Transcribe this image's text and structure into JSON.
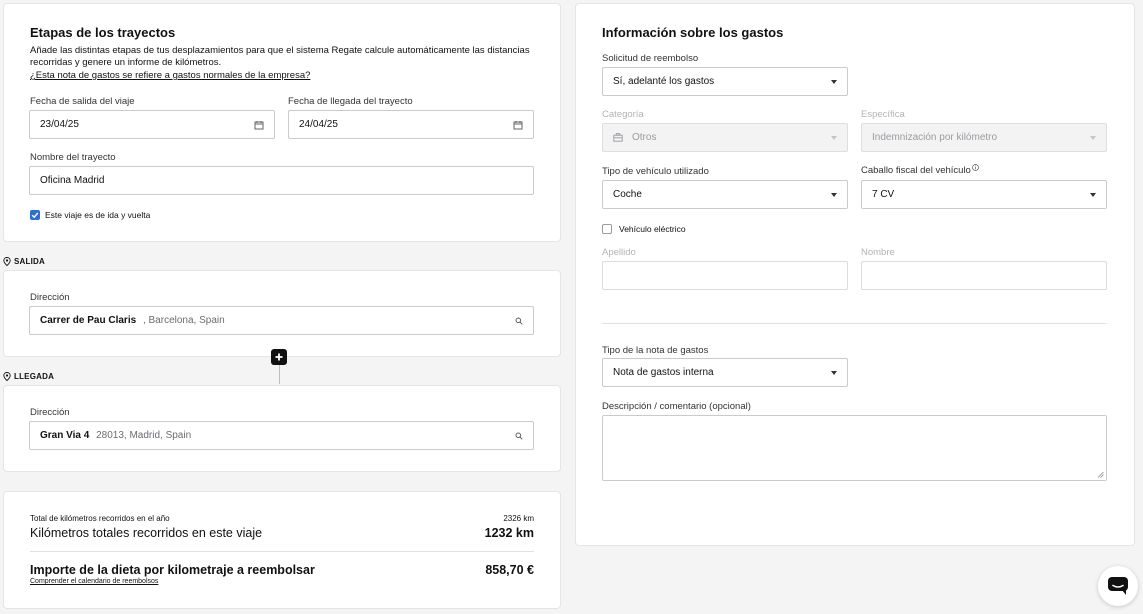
{
  "trips": {
    "title": "Etapas de los trayectos",
    "description": "Añade las distintas etapas de tus desplazamientos para que el sistema Regate calcule automáticamente las distancias recorridas y genere un informe de kilómetros.",
    "faq_link": "¿Esta nota de gastos se refiere a gastos normales de la empresa?",
    "departure_date_label": "Fecha de salida del viaje",
    "departure_date_value": "23/04/25",
    "arrival_date_label": "Fecha de llegada del trayecto",
    "arrival_date_value": "24/04/25",
    "trip_name_label": "Nombre del trayecto",
    "trip_name_value": "Oficina Madrid",
    "round_trip_label": "Este viaje es de ida y vuelta",
    "round_trip_checked": true
  },
  "departure": {
    "section_label": "SALIDA",
    "address_label": "Dirección",
    "address_main": "Carrer de Pau Claris",
    "address_rest": ", Barcelona, Spain"
  },
  "arrival": {
    "section_label": "LLEGADA",
    "address_label": "Dirección",
    "address_main": "Gran Via 4",
    "address_rest": "28013, Madrid, Spain"
  },
  "summary": {
    "year_km_label": "Total de kilómetros recorridos en el año",
    "year_km_value": "2326 km",
    "trip_km_label": "Kilómetros totales recorridos en este viaje",
    "trip_km_value": "1232 km",
    "reimburse_label": "Importe de la dieta por kilometraje a reembolsar",
    "reimburse_value": "858,70 €",
    "calendar_link": "Comprender el calendario de reembolsos"
  },
  "expenses": {
    "title": "Información sobre los gastos",
    "refund_label": "Solicitud de reembolso",
    "refund_value": "Sí, adelanté los gastos",
    "category_label": "Categoría",
    "category_value": "Otros",
    "specific_label": "Específica",
    "specific_value": "Indemnización por kilómetro",
    "vehicle_label": "Tipo de vehículo utilizado",
    "vehicle_value": "Coche",
    "fiscal_label": "Caballo fiscal del vehículo",
    "fiscal_value": "7 CV",
    "electric_label": "Vehículo eléctrico",
    "electric_checked": false,
    "lastname_label": "Apellido",
    "firstname_label": "Nombre",
    "note_type_label": "Tipo de la nota de gastos",
    "note_type_value": "Nota de gastos interna",
    "comment_label": "Descripción / comentario (opcional)"
  },
  "colors": {
    "accent": "#2f6fd1",
    "border": "#c9c9ce",
    "background": "#f4f4f5"
  },
  "icons": [
    "calendar-icon",
    "search-icon",
    "pin-icon",
    "plus-icon",
    "chevron-down-icon",
    "briefcase-icon",
    "info-icon",
    "chat-icon"
  ]
}
